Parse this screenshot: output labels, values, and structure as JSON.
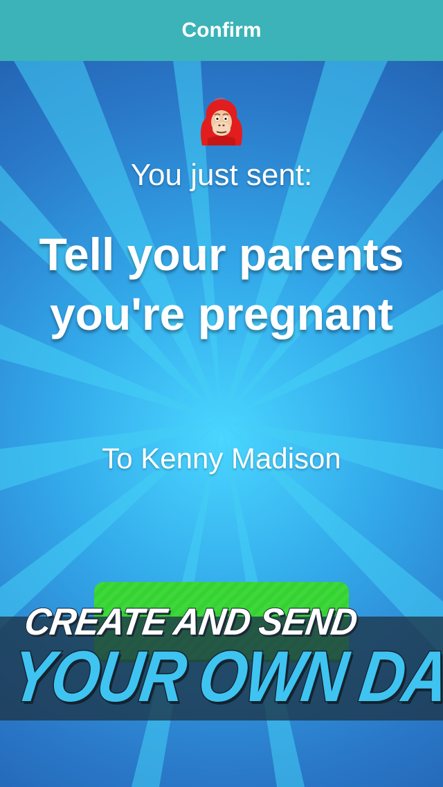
{
  "navbar": {
    "title": "Confirm"
  },
  "confirmation": {
    "sent_label": "You just sent:",
    "dare": "Tell your parents you're pregnant",
    "recipient": "To Kenny Madison"
  },
  "avatar": {
    "icon": "red-gorilla-avatar-icon"
  },
  "promo": {
    "line1": "CREATE AND SEND",
    "line2": "YOUR OWN DARES!"
  },
  "colors": {
    "navbar": "#3bb3b8",
    "background": "#2a76c2",
    "ray": "#44d0f5",
    "button": "#36d133",
    "promo_accent": "#3fc4f2"
  }
}
